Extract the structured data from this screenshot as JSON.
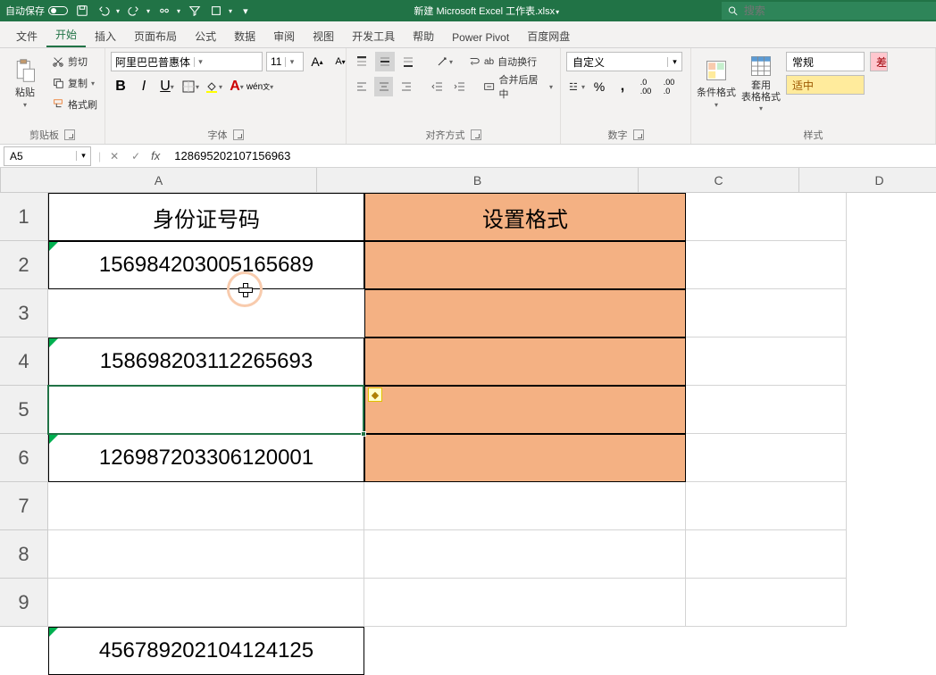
{
  "titlebar": {
    "autosave": "自动保存",
    "filename": "新建 Microsoft Excel 工作表.xlsx",
    "search_placeholder": "搜索"
  },
  "tabs": {
    "file": "文件",
    "home": "开始",
    "insert": "插入",
    "layout": "页面布局",
    "formulas": "公式",
    "data": "数据",
    "review": "审阅",
    "view": "视图",
    "dev": "开发工具",
    "help": "帮助",
    "powerpivot": "Power Pivot",
    "baidu": "百度网盘"
  },
  "ribbon": {
    "clipboard": {
      "paste": "粘贴",
      "cut": "剪切",
      "copy": "复制",
      "painter": "格式刷",
      "group": "剪贴板"
    },
    "font": {
      "name": "阿里巴巴普惠体",
      "size": "11",
      "group": "字体"
    },
    "align": {
      "wrap": "自动换行",
      "merge": "合并后居中",
      "group": "对齐方式"
    },
    "number": {
      "format": "自定义",
      "group": "数字"
    },
    "styles": {
      "condfmt": "条件格式",
      "tablefmt": "套用\n表格格式",
      "normal": "常规",
      "accent": "适中",
      "group": "样式",
      "bad": "差"
    }
  },
  "namebox": {
    "ref": "A5",
    "formula": "128695202107156963"
  },
  "sheet": {
    "col_widths": {
      "A": 354,
      "B": 360,
      "C": 180,
      "D": 180
    },
    "header_row_h": 54,
    "data_row_h": 54,
    "headers": {
      "A": "身份证号码",
      "B": "设置格式"
    },
    "rows": [
      {
        "id": "156984203005165689"
      },
      {
        "id": "158698203112265693"
      },
      {
        "id": "126987203306120001"
      },
      {
        "id": "128695202107156963"
      },
      {
        "id": "456789202104124125"
      }
    ],
    "row_labels": [
      "1",
      "2",
      "3",
      "4",
      "5",
      "6",
      "7",
      "8",
      "9"
    ],
    "col_labels": [
      "A",
      "B",
      "C",
      "D"
    ],
    "selected_cell": "A5"
  }
}
